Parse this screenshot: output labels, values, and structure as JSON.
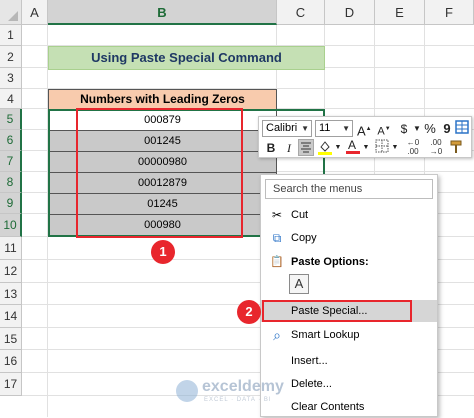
{
  "columns": [
    "A",
    "B",
    "C",
    "D",
    "E",
    "F"
  ],
  "rows": [
    "1",
    "2",
    "3",
    "4",
    "5",
    "6",
    "7",
    "8",
    "9",
    "10",
    "11",
    "12",
    "13",
    "14",
    "15",
    "16",
    "17"
  ],
  "title_cell": "Using Paste Special Command",
  "table": {
    "header": "Numbers with Leading Zeros",
    "values": [
      "000879",
      "001245",
      "00000980",
      "00012879",
      "01245",
      "000980"
    ]
  },
  "mini_toolbar": {
    "font_name": "Calibri",
    "font_size": "11",
    "buttons": {
      "grow_font": "A",
      "shrink_font": "A",
      "currency": "$",
      "percent": "%",
      "comma": "9",
      "bold": "B",
      "italic": "I"
    }
  },
  "context_menu": {
    "search_placeholder": "Search the menus",
    "items": [
      {
        "label": "Cut",
        "icon": "scissors-icon",
        "glyph": "✂"
      },
      {
        "label": "Copy",
        "icon": "copy-icon",
        "glyph": "⧉"
      },
      {
        "label": "Paste Options:",
        "icon": "clipboard-icon",
        "glyph": "📋"
      },
      {
        "label": "Paste Special...",
        "icon": "",
        "glyph": ""
      },
      {
        "label": "Smart Lookup",
        "icon": "search-icon",
        "glyph": "⌕"
      },
      {
        "label": "Insert...",
        "icon": "",
        "glyph": ""
      },
      {
        "label": "Delete...",
        "icon": "",
        "glyph": ""
      },
      {
        "label": "Clear Contents",
        "icon": "",
        "glyph": ""
      }
    ],
    "paste_option_glyph": "A"
  },
  "annotations": {
    "badge1": "1",
    "badge2": "2"
  },
  "watermark": {
    "name": "exceldemy",
    "tagline": "EXCEL · DATA · BI"
  },
  "colors": {
    "selection_green": "#217346",
    "annotation_red": "#e8262d",
    "title_fill": "#c5e0b4",
    "header_fill": "#f8cbad",
    "data_fill": "#c9c9c9"
  }
}
